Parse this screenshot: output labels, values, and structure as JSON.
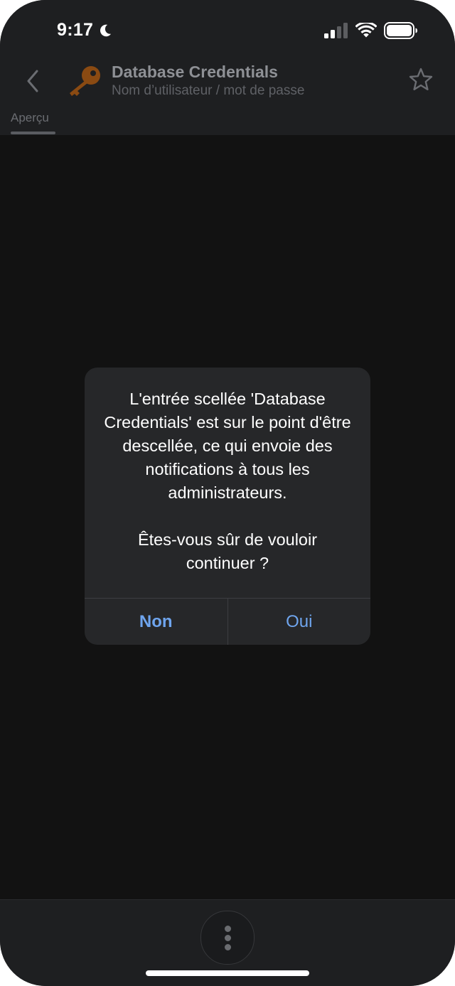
{
  "status_bar": {
    "time": "9:17",
    "icons": [
      "moon-icon",
      "signal-icon",
      "wifi-icon",
      "battery-icon"
    ]
  },
  "header": {
    "back_icon": "chevron-left-icon",
    "entry_icon": "key-icon",
    "title": "Database Credentials",
    "subtitle": "Nom d’utilisateur / mot de passe",
    "favorite_icon": "star-icon"
  },
  "tabs": [
    {
      "label": "Aperçu",
      "active": true
    }
  ],
  "dialog": {
    "message": "L'entrée scellée 'Database Credentials' est sur le point d'être descellée, ce qui envoie des notifications à tous les administrateurs.",
    "question": "Êtes-vous sûr de vouloir continuer ?",
    "buttons": {
      "cancel": "Non",
      "confirm": "Oui"
    }
  },
  "bottom_bar": {
    "more_icon": "more-vertical-icon"
  },
  "colors": {
    "background": "#121212",
    "bar": "#1e1f21",
    "dialog": "#262729",
    "accent": "#6fa5ee",
    "key": "#8a4a12"
  }
}
